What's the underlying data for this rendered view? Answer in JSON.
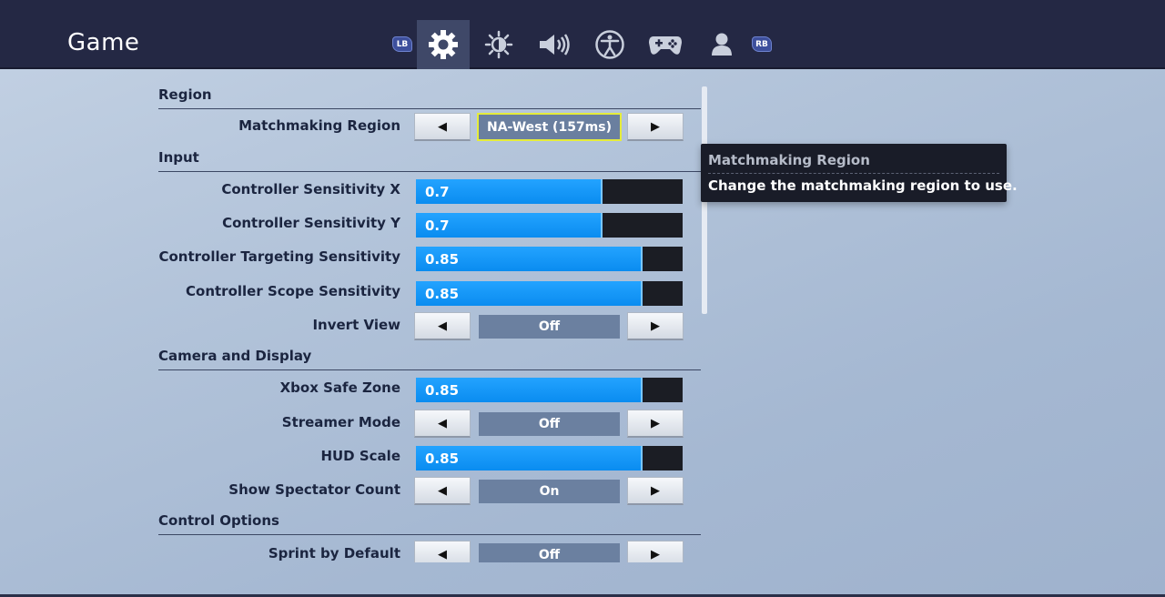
{
  "header": {
    "title": "Game",
    "left_bumper": "LB",
    "right_bumper": "RB",
    "tabs": [
      {
        "icon": "gear-icon",
        "active": true
      },
      {
        "icon": "brightness-icon",
        "active": false
      },
      {
        "icon": "speaker-icon",
        "active": false
      },
      {
        "icon": "accessibility-icon",
        "active": false
      },
      {
        "icon": "controller-icon",
        "active": false
      },
      {
        "icon": "account-icon",
        "active": false
      }
    ]
  },
  "sections": {
    "region": "Region",
    "input": "Input",
    "camera": "Camera and Display",
    "control": "Control Options"
  },
  "settings": {
    "matchmaking_region": {
      "label": "Matchmaking Region",
      "value": "NA-West (157ms)"
    },
    "controller_sensitivity_x": {
      "label": "Controller Sensitivity X",
      "value": "0.7",
      "fill_fraction": 0.7
    },
    "controller_sensitivity_y": {
      "label": "Controller Sensitivity Y",
      "value": "0.7",
      "fill_fraction": 0.7
    },
    "controller_targeting_sensitivity": {
      "label": "Controller Targeting Sensitivity",
      "value": "0.85",
      "fill_fraction": 0.85
    },
    "controller_scope_sensitivity": {
      "label": "Controller Scope Sensitivity",
      "value": "0.85",
      "fill_fraction": 0.85
    },
    "invert_view": {
      "label": "Invert View",
      "value": "Off"
    },
    "xbox_safe_zone": {
      "label": "Xbox Safe Zone",
      "value": "0.85",
      "fill_fraction": 0.85
    },
    "streamer_mode": {
      "label": "Streamer Mode",
      "value": "Off"
    },
    "hud_scale": {
      "label": "HUD Scale",
      "value": "0.85",
      "fill_fraction": 0.85
    },
    "show_spectator_count": {
      "label": "Show Spectator Count",
      "value": "On"
    },
    "sprint_by_default": {
      "label": "Sprint by Default",
      "value": "Off"
    }
  },
  "arrows": {
    "left": "◀",
    "right": "▶"
  },
  "tooltip": {
    "title": "Matchmaking Region",
    "body": "Change the matchmaking region to use."
  },
  "colors": {
    "header_bg": "#242844",
    "slider_fill": "#1796f8",
    "selected_outline": "#e5ec3a"
  }
}
